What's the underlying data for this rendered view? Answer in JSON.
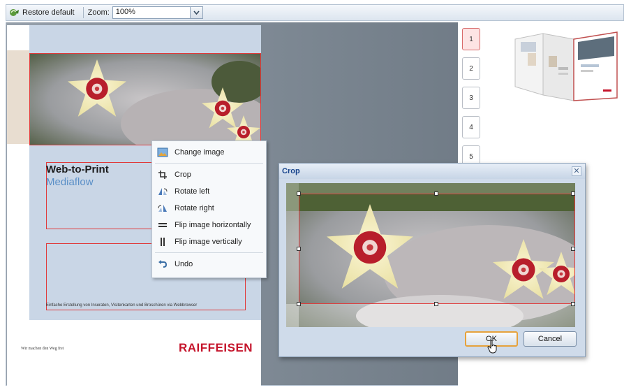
{
  "toolbar": {
    "restore_label": "Restore default",
    "zoom_label": "Zoom:",
    "zoom_value": "100%"
  },
  "document": {
    "headline": "Web-to-Print",
    "subheadline": "Mediaflow",
    "body_text": "Einfache Erstellung von Inseraten, Visitenkarten und Broschüren via Webbrowser",
    "slogan": "Wir machen den Weg frei",
    "brand": "RAIFFEISEN"
  },
  "pages": [
    {
      "label": "1",
      "active": true
    },
    {
      "label": "2",
      "active": false
    },
    {
      "label": "3",
      "active": false
    },
    {
      "label": "4",
      "active": false
    },
    {
      "label": "5",
      "active": false
    }
  ],
  "context_menu": {
    "items": [
      "Change image",
      "Crop",
      "Rotate left",
      "Rotate right",
      "Flip image horizontally",
      "Flip image vertically",
      "Undo"
    ],
    "icons": [
      "picture-icon",
      "crop-icon",
      "rotate-left-icon",
      "rotate-right-icon",
      "flip-horizontal-icon",
      "flip-vertical-icon",
      "undo-icon"
    ]
  },
  "crop_dialog": {
    "title": "Crop",
    "ok_label": "OK",
    "cancel_label": "Cancel"
  },
  "colors": {
    "accent_red": "#e03a3a",
    "brand_red": "#c5142b",
    "link_blue": "#5a8fc7"
  }
}
